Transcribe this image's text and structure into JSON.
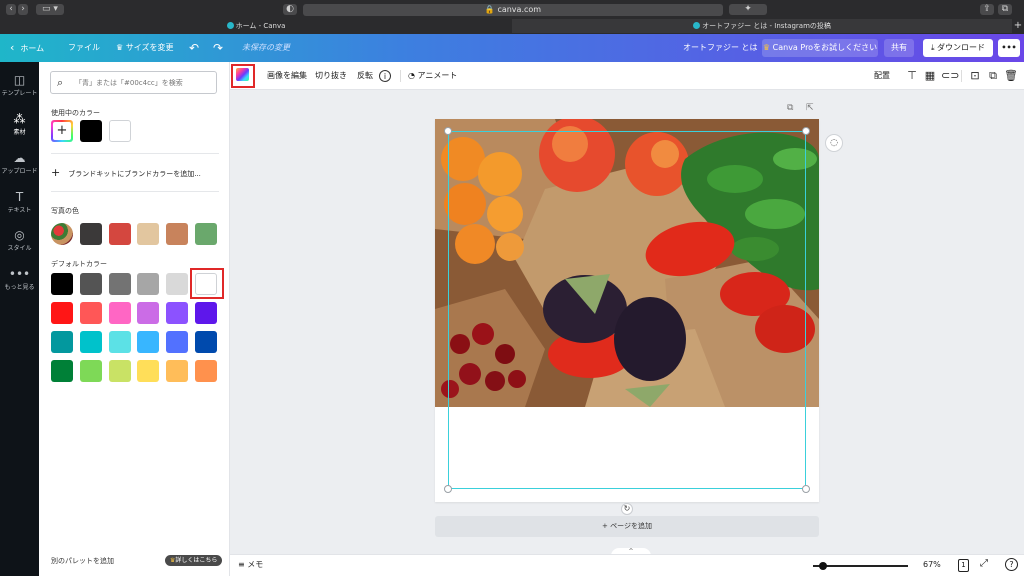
{
  "browser": {
    "url": "canva.com",
    "tabs": [
      {
        "label": "ホーム - Canva"
      },
      {
        "label": "オートファジー とは - Instagramの投稿"
      }
    ]
  },
  "header": {
    "home": "ホーム",
    "file": "ファイル",
    "resize": "サイズを変更",
    "unsaved": "未保存の変更",
    "doc_title": "オートファジー とは",
    "pro_button": "Canva Proをお試しください",
    "share": "共有",
    "download": "ダウンロード",
    "more": "•••"
  },
  "rail": {
    "items": [
      {
        "label": "テンプレート",
        "icon": "template-icon"
      },
      {
        "label": "素材",
        "icon": "elements-icon"
      },
      {
        "label": "アップロード",
        "icon": "upload-icon"
      },
      {
        "label": "テキスト",
        "icon": "text-icon"
      },
      {
        "label": "スタイル",
        "icon": "style-icon"
      },
      {
        "label": "もっと見る",
        "icon": "more-icon"
      }
    ]
  },
  "panel": {
    "search_placeholder": "「青」または「#00c4cc」を検索",
    "in_use_title": "使用中のカラー",
    "in_use_colors": [
      "#000000",
      "#ffffff"
    ],
    "brand_kit": "ブランドキットにブランドカラーを追加...",
    "photo_colors_title": "写真の色",
    "photo_colors": [
      "#3b3939",
      "#d4473f",
      "#e2c69f",
      "#c8835c",
      "#6aa86c"
    ],
    "default_title": "デフォルトカラー",
    "default_colors": [
      [
        "#000000",
        "#545454",
        "#737373",
        "#a6a6a6",
        "#d9d9d9",
        "#ffffff"
      ],
      [
        "#ff1616",
        "#ff5757",
        "#ff66c4",
        "#cb6ce6",
        "#8c52ff",
        "#5e17eb"
      ],
      [
        "#03989e",
        "#00c2cb",
        "#5ce1e6",
        "#38b6ff",
        "#5271ff",
        "#004aad"
      ],
      [
        "#008037",
        "#7ed957",
        "#c9e265",
        "#ffde59",
        "#ffbd59",
        "#ff914d"
      ]
    ],
    "footer_label": "別のパレットを追加",
    "footer_badge": "詳しくはこちら"
  },
  "toolbar": {
    "edit_image": "画像を編集",
    "crop": "切り抜き",
    "flip": "反転",
    "animate": "アニメート",
    "position": "配置"
  },
  "canvas": {
    "add_page": "+ ページを追加"
  },
  "bottom": {
    "notes": "メモ",
    "zoom": "67%",
    "page_count": "1",
    "help": "?",
    "zoom_level": 0.3
  },
  "colors": {
    "accent": "#00c4cc",
    "highlight": "#e02828"
  }
}
